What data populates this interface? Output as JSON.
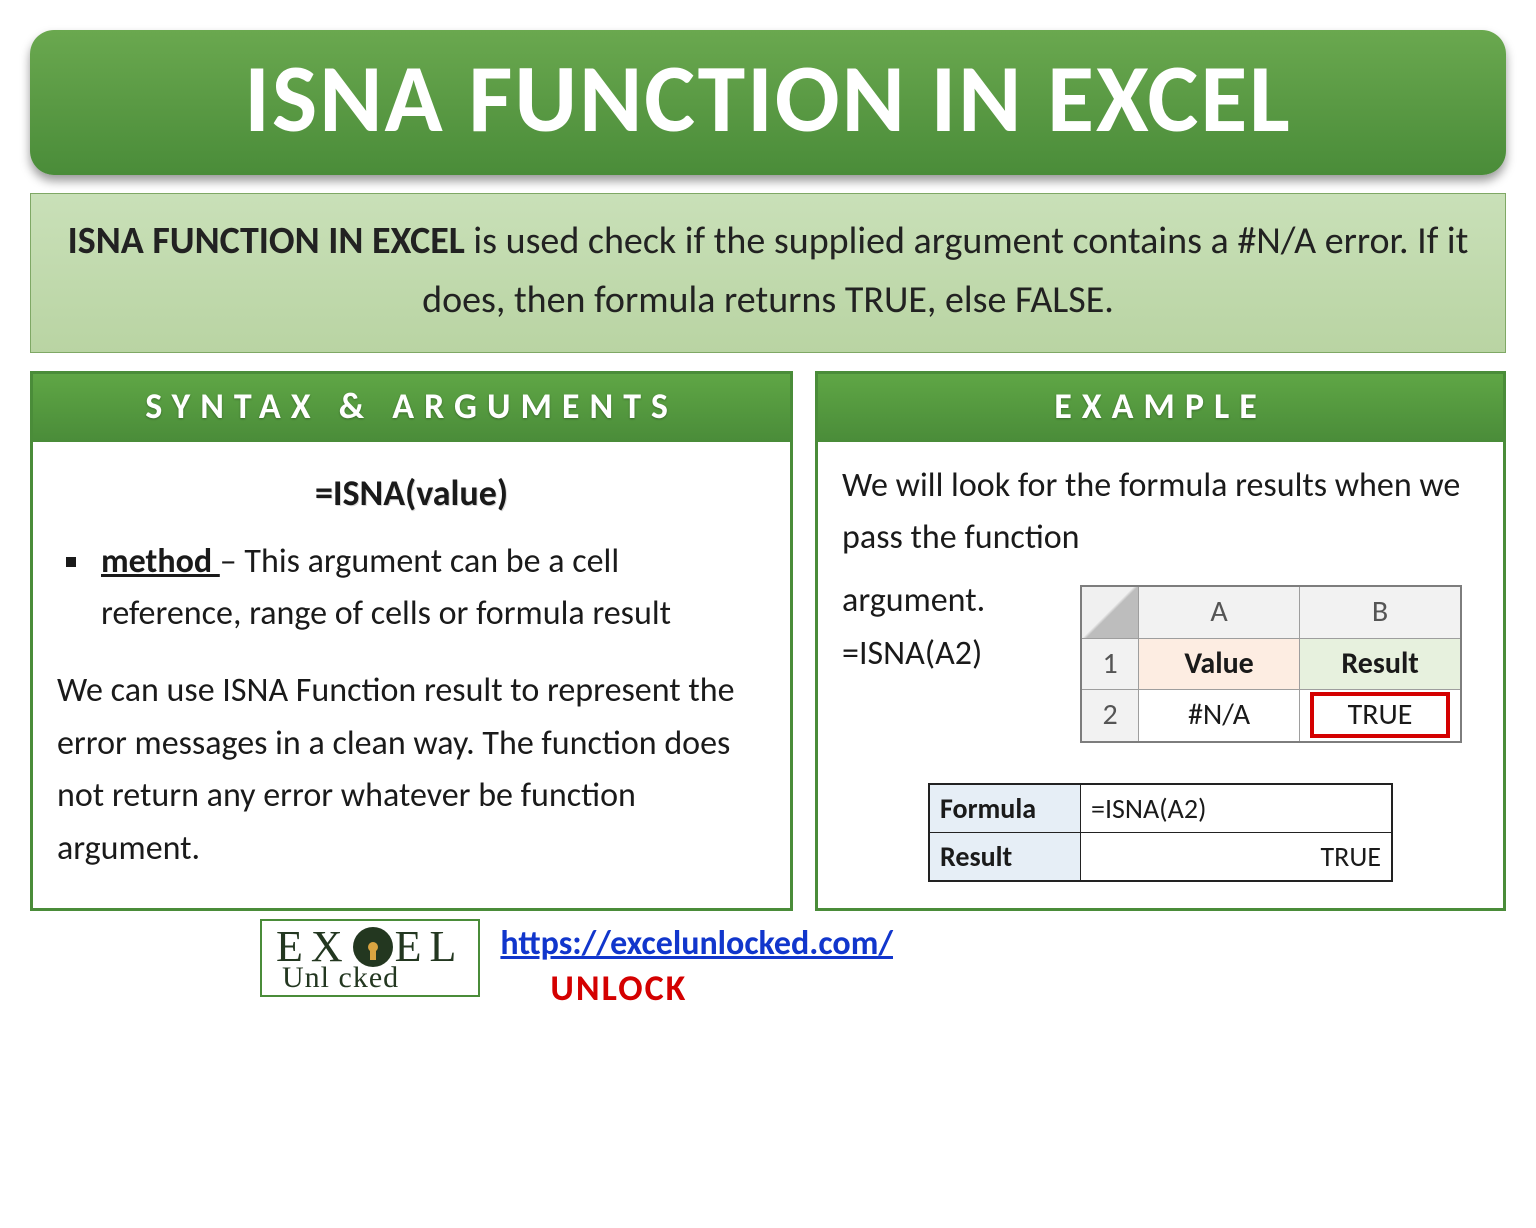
{
  "title": "ISNA FUNCTION IN EXCEL",
  "description": {
    "bold": "ISNA FUNCTION IN EXCEL",
    "rest": " is used check if the supplied argument contains a #N/A error. If it does, then formula returns TRUE, else FALSE."
  },
  "left": {
    "header": "SYNTAX & ARGUMENTS",
    "syntax": "=ISNA(value)",
    "arg_name": "method ",
    "arg_desc": "– This argument can be a cell reference, range of cells or formula result",
    "note": "We can use ISNA Function result to represent the error messages in a clean way. The function does not return any error whatever be function argument."
  },
  "right": {
    "header": "EXAMPLE",
    "intro1": "We will look for the formula results when we pass the function",
    "intro2a": "argument.",
    "intro2b": "=ISNA(A2)",
    "sheet": {
      "colA": "A",
      "colB": "B",
      "r1": "1",
      "r2": "2",
      "h_value": "Value",
      "h_result": "Result",
      "c_a2": "#N/A",
      "c_b2": "TRUE"
    },
    "result_tbl": {
      "l_formula": "Formula",
      "v_formula": "=ISNA(A2)",
      "l_result": "Result",
      "v_result": "TRUE"
    }
  },
  "footer": {
    "logo1a": "EX",
    "logo1b": "EL",
    "logo2": "Unl   cked",
    "url": "https://excelunlocked.com/",
    "unlock": "UNLOCK"
  }
}
